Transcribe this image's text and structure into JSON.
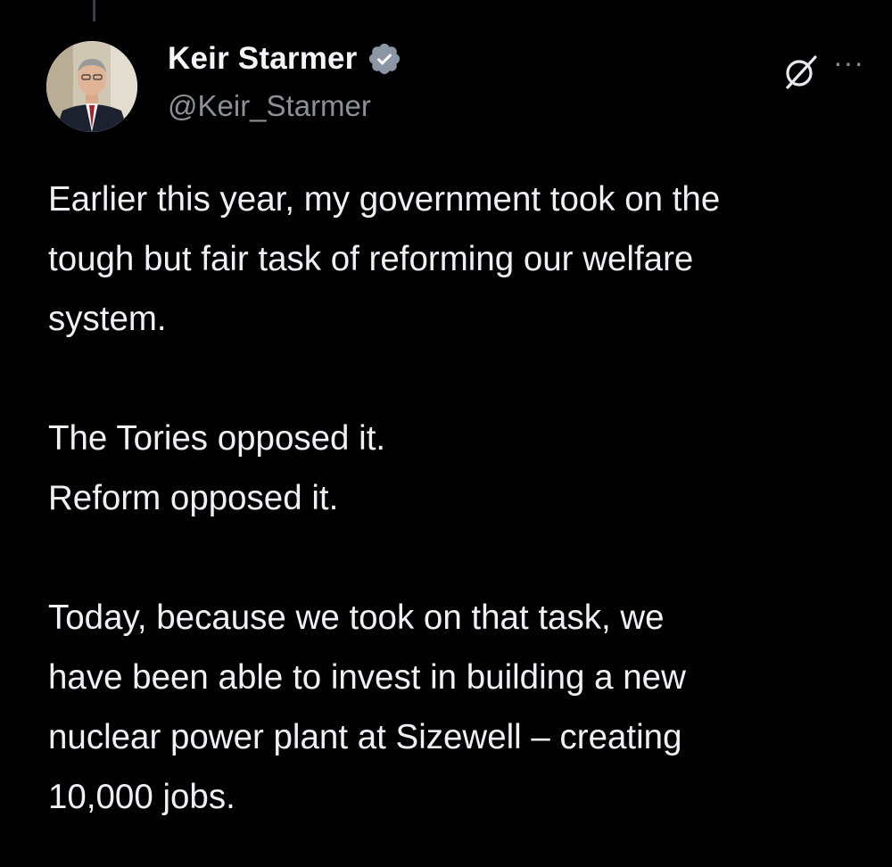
{
  "author": {
    "display_name": "Keir Starmer",
    "handle": "@Keir_Starmer",
    "verified_icon": "verified-badge-icon",
    "verified_color": "#8a96a3"
  },
  "actions": {
    "grok_icon": "grok-icon",
    "more_label": "···"
  },
  "tweet": {
    "p1_l1": "Earlier this year, my government took on the",
    "p1_l2": "tough but fair task of reforming our welfare",
    "p1_l3": "system.",
    "p2_l1": "The Tories opposed it.",
    "p2_l2": "Reform opposed it.",
    "p3_l1": "Today, because we took on that task, we",
    "p3_l2": "have been able to invest in building a new",
    "p3_l3": "nuclear power plant at Sizewell – creating",
    "p3_l4": "10,000 jobs."
  },
  "colors": {
    "background": "#000000",
    "text": "#eef0f1",
    "secondary": "#8b9196"
  }
}
